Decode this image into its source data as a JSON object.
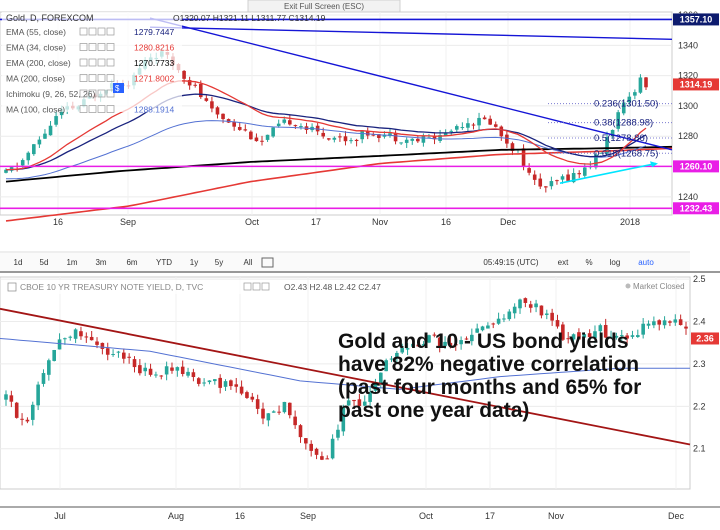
{
  "exit_fullscreen": "Exit Full Screen (ESC)",
  "colors": {
    "up": "#26a69a",
    "down": "#c62828",
    "ema55": "#1a237e",
    "ema34": "#e53935",
    "ema200": "#000000",
    "ma200": "#e53935",
    "ma100": "#5472d3",
    "trend_blue": "#1515d6",
    "magenta": "#e91ee6",
    "red_trend": "#a31515",
    "cyan": "#00e5ff",
    "tag_dark": "#0d1b6e",
    "tag_red": "#e53935",
    "tag_magenta": "#e91ee6",
    "panel_border": "#333333"
  },
  "toolbar": {
    "items": [
      "1d",
      "5d",
      "1m",
      "3m",
      "6m",
      "YTD",
      "1y",
      "5y",
      "All"
    ],
    "clock": "05:49:15 (UTC)",
    "right_items": [
      "ext",
      "%",
      "log",
      "auto"
    ]
  },
  "chart_data": [
    {
      "type": "candlestick",
      "title": "Gold, D, FOREXCOM",
      "ohlc_text": "O1320.07 H1321.11 L1311.77 C1314.19",
      "x_ticks": [
        "16",
        "Sep",
        "Oct",
        "17",
        "Nov",
        "16",
        "Dec",
        "2018"
      ],
      "y_ticks": [
        1240,
        1260,
        1280,
        1300,
        1320,
        1340,
        1360
      ],
      "ylim": [
        1228,
        1362
      ],
      "legend": [
        {
          "label": "EMA (55, close)",
          "value": "1279.7447"
        },
        {
          "label": "EMA (34, close)",
          "value": "1280.8216"
        },
        {
          "label": "EMA (200, close)",
          "value": "1270.7733"
        },
        {
          "label": "MA (200, close)",
          "value": "1271.8002"
        },
        {
          "label": "Ichimoku (9, 26, 52, 26)",
          "value": ""
        },
        {
          "label": "MA (100, close)",
          "value": "1288.1914"
        }
      ],
      "price_tags": [
        {
          "value": 1357.1,
          "label": "1357.10"
        },
        {
          "value": 1314.19,
          "label": "1314.19"
        },
        {
          "value": 1260.1,
          "label": "1260.10"
        },
        {
          "value": 1232.43,
          "label": "1232.43"
        }
      ],
      "fib_levels": [
        {
          "value": 1301.5,
          "label": "0.236(1301.50)"
        },
        {
          "value": 1288.98,
          "label": "0.38(1288.98)"
        },
        {
          "value": 1278.86,
          "label": "0.5(1278.86)"
        },
        {
          "value": 1268.75,
          "label": "0.618(1268.75)"
        }
      ],
      "horizontal_levels": [
        1357.1,
        1260.1,
        1232.43
      ]
    },
    {
      "type": "candlestick",
      "title": "CBOE 10 YR TREASURY NOTE YIELD, D, TVC",
      "ohlc_text": "O2.43 H2.48 L2.42 C2.47",
      "status": "Market Closed",
      "x_ticks": [
        "Jul",
        "Aug",
        "16",
        "Sep",
        "Oct",
        "17",
        "Nov",
        "Dec"
      ],
      "y_ticks": [
        2.1,
        2.2,
        2.3,
        2.4,
        2.5
      ],
      "ylim": [
        2.005,
        2.505
      ],
      "price_tags": [
        {
          "value": 2.36,
          "label": "2.36"
        }
      ],
      "annotation": {
        "lines": [
          "Gold and 10 - US bond yields",
          "have 82% negative correlation",
          "(past four months and 65% for",
          "past one year data)"
        ]
      }
    }
  ]
}
